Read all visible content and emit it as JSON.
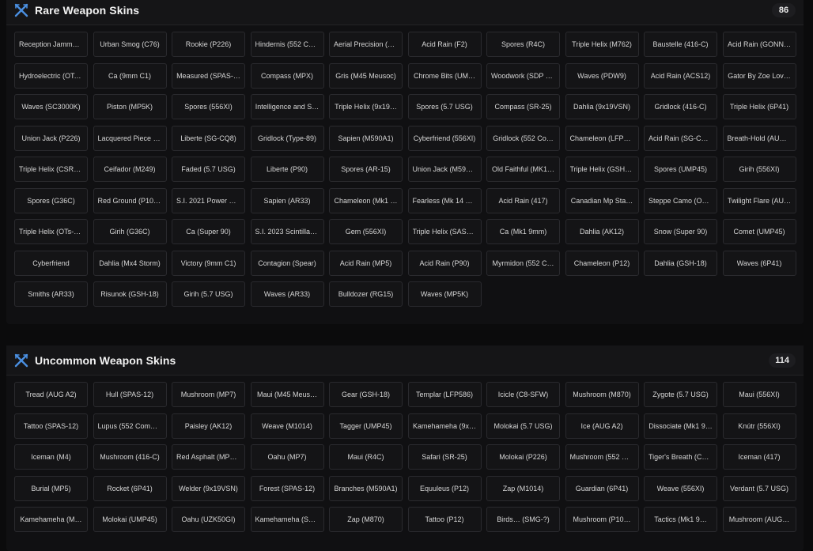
{
  "rare": {
    "title": "Rare Weapon Skins",
    "count": "86",
    "items": [
      "Reception Jamme…",
      "Urban Smog (C76)",
      "Rookie (P226)",
      "Hindernis (552 Co…",
      "Aerial Precision (S…",
      "Acid Rain (F2)",
      "Spores (R4C)",
      "Triple Helix (M762)",
      "Baustelle (416-C)",
      "Acid Rain (GONN…",
      "Hydroelectric (OTs…",
      "Ca (9mm C1)",
      "Measured (SPAS-…",
      "Compass (MPX)",
      "Gris (M45 Meusoc)",
      "Chrome Bits (UM…",
      "Woodwork (SDP 9…",
      "Waves (PDW9)",
      "Acid Rain (ACS12)",
      "Gator By Zoe Lov…",
      "Waves (SC3000K)",
      "Piston (MP5K)",
      "Spores (556XI)",
      "Intelligence and S…",
      "Triple Helix (9x19…",
      "Spores (5.7 USG)",
      "Compass (SR-25)",
      "Dahlia (9x19VSN)",
      "Gridlock (416-C)",
      "Triple Helix (6P41)",
      "Union Jack (P226)",
      "Lacquered Piece (…",
      "Liberte (SG-CQ8)",
      "Gridlock (Type-89)",
      "Sapien (M590A1)",
      "Cyberfriend (556XI)",
      "Gridlock (552 Co…",
      "Chameleon (LFP5…",
      "Acid Rain (SG-CQ8)",
      "Breath-Hold (AUG…",
      "Triple Helix (CSRX…",
      "Ceifador (M249)",
      "Faded (5.7 USG)",
      "Liberte (P90)",
      "Spores (AR-15)",
      "Union Jack (M590…",
      "Old Faithful (MK1…",
      "Triple Helix (GSH-…",
      "Spores (UMP45)",
      "Girih (556XI)",
      "Spores (G36C)",
      "Red Ground (P10 …",
      "S.I. 2021 Power Pr…",
      "Sapien (AR33)",
      "Chameleon (Mk1 …",
      "Fearless (Mk 14 E…",
      "Acid Rain (417)",
      "Canadian Mp Sta…",
      "Steppe Camo (OT…",
      "Twilight Flare (AU…",
      "Triple Helix (OTs-0…",
      "Girih (G36C)",
      "Ca (Super 90)",
      "S.I. 2023 Scintilla (…",
      "Gem (556XI)",
      "Triple Helix (SASG…",
      "Ca (Mk1 9mm)",
      "Dahlia (AK12)",
      "Snow (Super 90)",
      "Comet (UMP45)",
      "Cyberfriend",
      "Dahlia (Mx4 Storm)",
      "Victory (9mm C1)",
      "Contagion (Spear)",
      "Acid Rain (MP5)",
      "Acid Rain (P90)",
      "Myrmidon (552 C…",
      "Chameleon (P12)",
      "Dahlia (GSH-18)",
      "Waves (6P41)",
      "Smiths (AR33)",
      "Risunok (GSH-18)",
      "Girih (5.7 USG)",
      "Waves (AR33)",
      "Bulldozer (RG15)",
      "Waves (MP5K)"
    ]
  },
  "uncommon": {
    "title": "Uncommon Weapon Skins",
    "count": "114",
    "items": [
      "Tread (AUG A2)",
      "Hull (SPAS-12)",
      "Mushroom (MP7)",
      "Maui (M45 Meus…",
      "Gear (GSH-18)",
      "Templar (LFP586)",
      "Icicle (C8-SFW)",
      "Mushroom (M870)",
      "Zygote (5.7 USG)",
      "Maui (556XI)",
      "Tattoo (SPAS-12)",
      "Lupus (552 Comm…",
      "Paisley (AK12)",
      "Weave (M1014)",
      "Tagger (UMP45)",
      "Kamehameha (9x…",
      "Molokai (5.7 USG)",
      "Ice (AUG A2)",
      "Dissociate (Mk1 9…",
      "Knútr (556XI)",
      "Iceman (M4)",
      "Mushroom (416-C)",
      "Red Asphalt (MP5K)",
      "Oahu (MP7)",
      "Maui (R4C)",
      "Safari (SR-25)",
      "Molokai (P226)",
      "Mushroom (552 C…",
      "Tiger's Breath (C8…",
      "Iceman (417)",
      "Burial (MP5)",
      "Rocket (6P41)",
      "Welder (9x19VSN)",
      "Forest (SPAS-12)",
      "Branches (M590A1)",
      "Equuleus (P12)",
      "Zap (M1014)",
      "Guardian (6P41)",
      "Weave (556XI)",
      "Verdant (5.7 USG)",
      "Kamehameha (M…",
      "Molokai (UMP45)",
      "Oahu (UZK50GI)",
      "Kamehameha (SG…",
      "Zap (M870)",
      "Tattoo (P12)",
      "Birds… (SMG-?)",
      "Mushroom (P10…",
      "Tactics (Mk1 9…",
      "Mushroom (AUG…"
    ]
  },
  "icons": {
    "section": "crossed-swords-icon"
  },
  "colors": {
    "accent": "#4a8fe0",
    "background": "#0b0b0c"
  }
}
